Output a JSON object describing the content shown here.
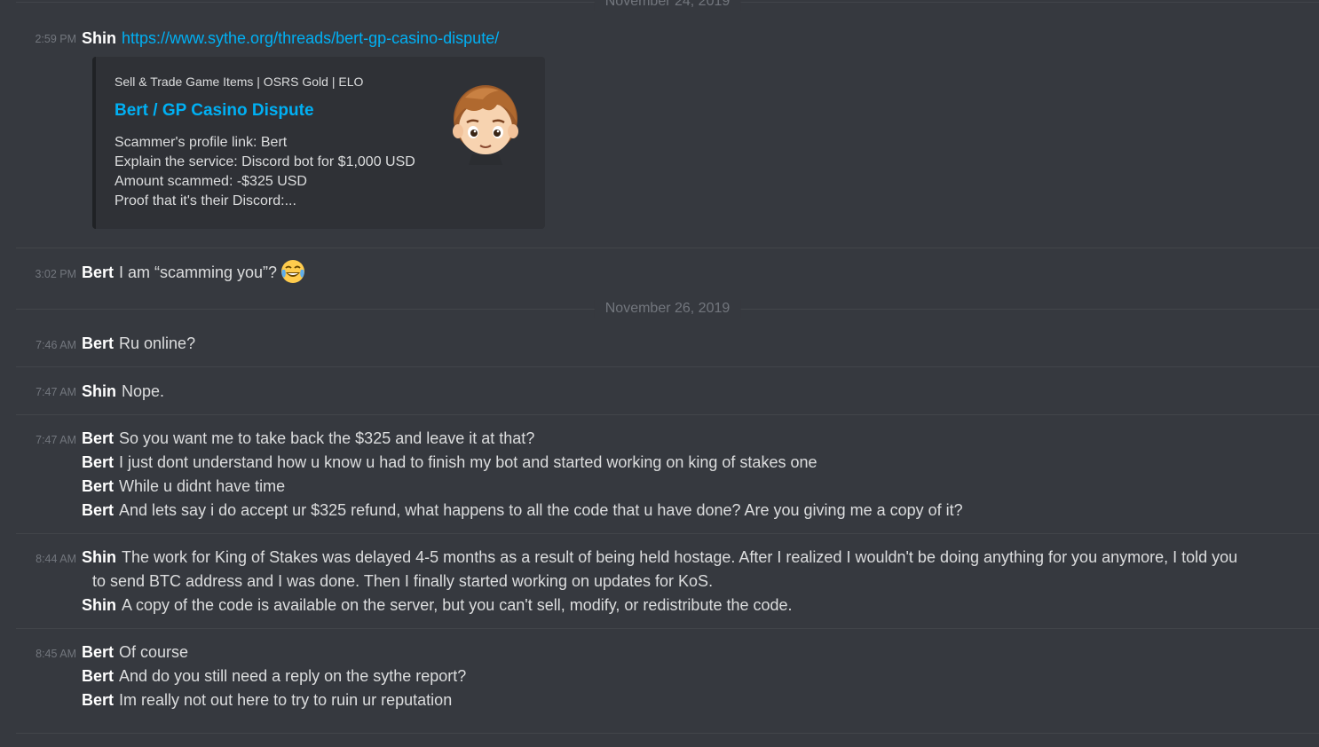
{
  "top_date": "November 24, 2019",
  "messages": [
    {
      "time": "2:59 PM",
      "author": "Shin",
      "link": "https://www.sythe.org/threads/bert-gp-casino-dispute/"
    },
    {
      "time": "3:02 PM",
      "author": "Bert",
      "text": "I am “scamming you”?",
      "emoji": "joy-emoji"
    }
  ],
  "embed": {
    "provider": "Sell & Trade Game Items | OSRS Gold | ELO",
    "title": "Bert / GP Casino Dispute",
    "desc": [
      "Scammer's profile link: Bert",
      "Explain the service: Discord bot for $1,000 USD",
      "Amount scammed: -$325 USD",
      "Proof that it's their Discord:..."
    ],
    "thumbnail": "avatar-cartoon-boy"
  },
  "date2": "November 26, 2019",
  "group2": [
    {
      "time": "7:46 AM",
      "author": "Bert",
      "text": "Ru online?"
    },
    {
      "time": "7:47 AM",
      "author": "Shin",
      "text": "Nope."
    }
  ],
  "group3": {
    "time": "7:47 AM",
    "lines": [
      {
        "author": "Bert",
        "text": "So you want me to take back the $325 and leave it at that?"
      },
      {
        "author": "Bert",
        "text": "I just dont understand how u know u had to finish my bot and started working on king of stakes one"
      },
      {
        "author": "Bert",
        "text": "While u didnt have time"
      },
      {
        "author": "Bert",
        "text": "And lets say i do accept ur $325 refund, what happens to all the code that u have done? Are you giving me a copy of it?"
      }
    ]
  },
  "group4": {
    "time": "8:44 AM",
    "line1_author": "Shin",
    "line1_a": "The work for King of Stakes was delayed 4-5 months as a result of being held hostage. After I realized I wouldn't be doing anything for you anymore, I told you",
    "line1_b": "to send BTC address and I was done. Then I finally started working on updates for KoS.",
    "line2_author": "Shin",
    "line2": "A copy of the code is available on the server, but you can't sell, modify, or redistribute the code."
  },
  "group5": {
    "time": "8:45 AM",
    "lines": [
      {
        "author": "Bert",
        "text": "Of course"
      },
      {
        "author": "Bert",
        "text": "And do you still need a reply on the sythe report?"
      },
      {
        "author": "Bert",
        "text": "Im really not out here to try to ruin ur reputation"
      }
    ]
  },
  "colors": {
    "background": "#36393f",
    "embed_background": "#2f3136",
    "link": "#00b0f4",
    "timestamp": "#72767d",
    "text": "#dcddde",
    "author": "#ffffff"
  }
}
